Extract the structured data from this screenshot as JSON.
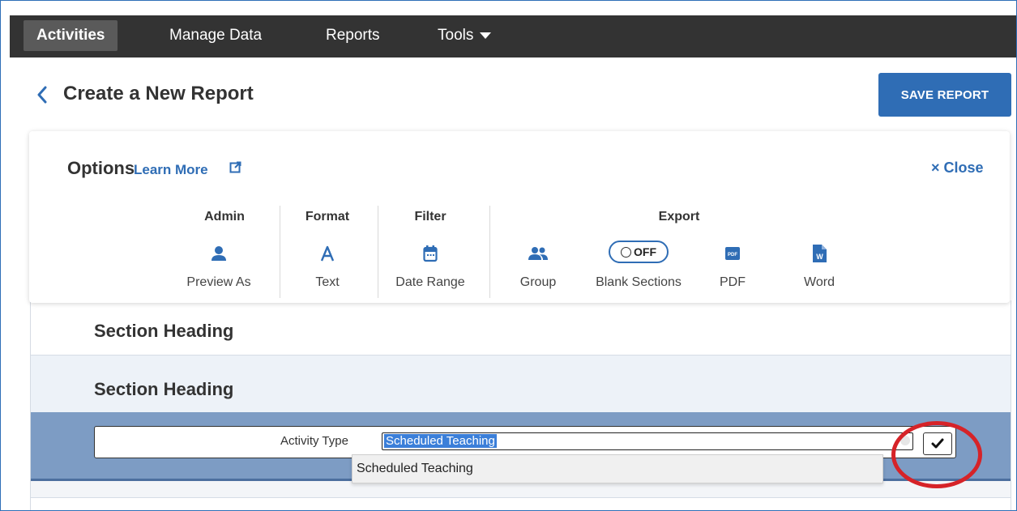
{
  "nav": {
    "items": [
      {
        "label": "Activities"
      },
      {
        "label": "Manage Data"
      },
      {
        "label": "Reports"
      },
      {
        "label": "Tools"
      }
    ],
    "active": "Activities"
  },
  "header": {
    "title": "Create a New Report",
    "save_label": "SAVE REPORT"
  },
  "options": {
    "title": "Options",
    "learn_more": "Learn More",
    "close_label": "× Close",
    "groups": {
      "admin": "Admin",
      "format": "Format",
      "filter": "Filter",
      "export": "Export"
    },
    "tools": {
      "preview_as": "Preview As",
      "text": "Text",
      "date_range": "Date Range",
      "group": "Group",
      "blank_sections": "Blank Sections",
      "blank_sections_state": "OFF",
      "pdf": "PDF",
      "word": "Word"
    },
    "icons": [
      "person-icon",
      "font-icon",
      "calendar-icon",
      "people-icon",
      "toggle-icon",
      "pdf-icon",
      "word-icon"
    ]
  },
  "sections": [
    {
      "heading": "Section Heading"
    },
    {
      "heading": "Section Heading"
    }
  ],
  "field": {
    "label": "Activity Type",
    "value": "Scheduled Teaching",
    "dropdown_option": "Scheduled Teaching"
  },
  "colors": {
    "accent": "#2f6db5",
    "nav_bg": "#333333",
    "selection": "#3b7fd9",
    "highlight_circle": "#d62328"
  }
}
